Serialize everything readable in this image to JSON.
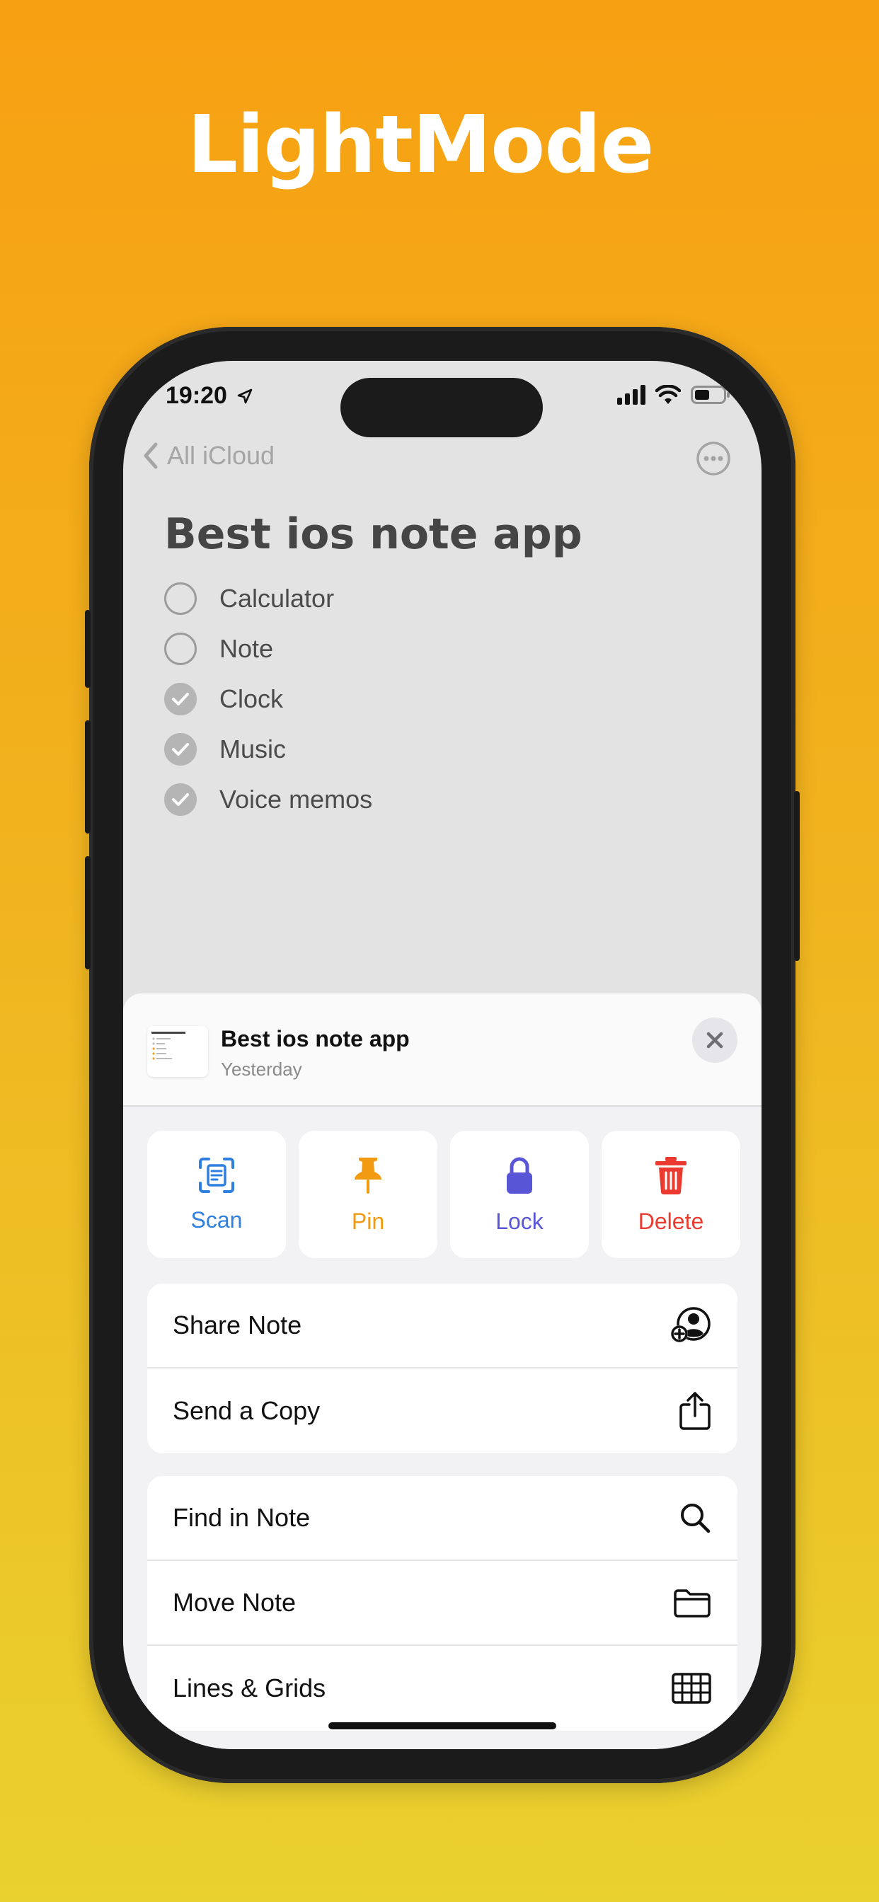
{
  "headline": "LightMode",
  "status": {
    "time": "19:20"
  },
  "nav": {
    "back_label": "All iCloud"
  },
  "note": {
    "title": "Best ios note app",
    "items": [
      {
        "label": "Calculator",
        "checked": false
      },
      {
        "label": "Note",
        "checked": false
      },
      {
        "label": "Clock",
        "checked": true
      },
      {
        "label": "Music",
        "checked": true
      },
      {
        "label": "Voice memos",
        "checked": true
      }
    ]
  },
  "sheet": {
    "title": "Best ios note app",
    "subtitle": "Yesterday",
    "actions": [
      {
        "label": "Scan",
        "icon": "scan-icon",
        "color": "#2f7fe0"
      },
      {
        "label": "Pin",
        "icon": "pin-icon",
        "color": "#f29a12"
      },
      {
        "label": "Lock",
        "icon": "lock-icon",
        "color": "#5856d6"
      },
      {
        "label": "Delete",
        "icon": "trash-icon",
        "color": "#eb3b30"
      }
    ],
    "group1": [
      {
        "label": "Share Note",
        "icon": "share-person-icon"
      },
      {
        "label": "Send a Copy",
        "icon": "share-upload-icon"
      }
    ],
    "group2": [
      {
        "label": "Find in Note",
        "icon": "search-icon"
      },
      {
        "label": "Move Note",
        "icon": "folder-icon"
      },
      {
        "label": "Lines & Grids",
        "icon": "grid-icon"
      }
    ]
  },
  "colors": {
    "bg_top": "#f7a012",
    "bg_bottom": "#e9d12f"
  }
}
